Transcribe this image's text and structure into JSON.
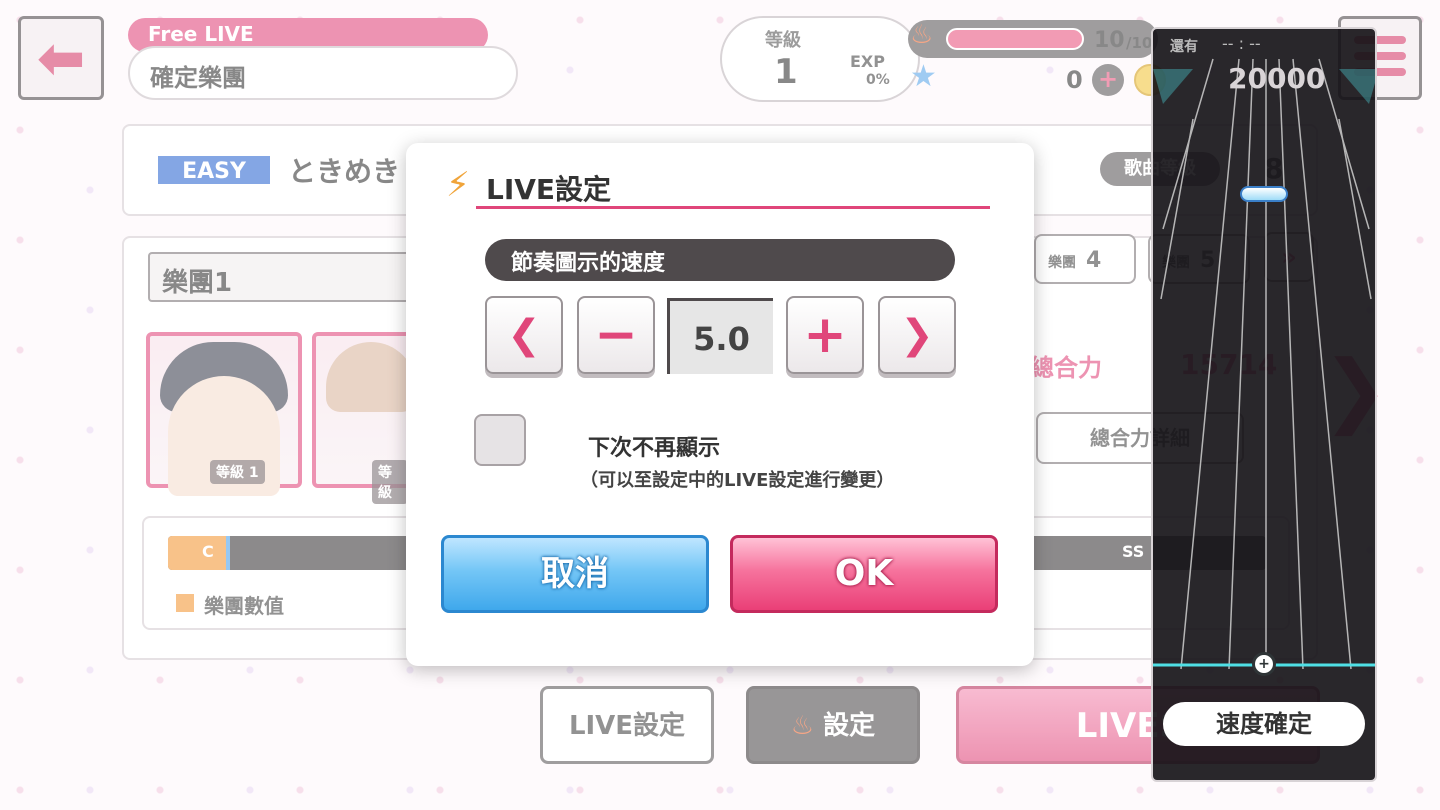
{
  "header": {
    "mode_label": "Free LIVE",
    "screen_title": "確定樂團",
    "level_label": "等級",
    "level_value": "1",
    "exp_label": "EXP",
    "exp_value": "0%",
    "stamina_value": "10",
    "stamina_max": "/10",
    "star_count": "0",
    "plus_label": "+"
  },
  "song": {
    "difficulty": "EASY",
    "title": "ときめき",
    "diff_label": "歌曲等級",
    "diff_value": "8"
  },
  "band": {
    "name": "樂團1",
    "tabs": [
      {
        "label": "樂團",
        "num": "4"
      },
      {
        "label": "樂團",
        "num": "5"
      }
    ],
    "next_label": "»",
    "cards": [
      {
        "level_label": "等級",
        "level": "1"
      },
      {
        "level_label": "等級",
        "level": ""
      }
    ],
    "power_label": "總合力",
    "power_value": "15714",
    "power_detail_label": "總合力詳細",
    "rank_c": "C",
    "rank_ss": "SS",
    "legend_label": "樂團數值"
  },
  "bottom_buttons": {
    "live_settings": "LIVE設定",
    "settings": "設定",
    "start": "LIVESt"
  },
  "modal": {
    "title": "LIVE設定",
    "speed_header": "節奏圖示的速度",
    "speed_value": "5.0",
    "prev_glyph": "❮",
    "minus_glyph": "−",
    "plus_glyph": "+",
    "next_glyph": "❯",
    "hide_label": "下次不再顯示",
    "hide_note": "（可以至設定中的LIVE設定進行變更）",
    "cancel_label": "取消",
    "ok_label": "OK"
  },
  "preview": {
    "remain_label": "還有",
    "time_text": "-- : --",
    "score": "20000",
    "confirm_label": "速度確定"
  },
  "colors": {
    "accent_pink": "#e0467a",
    "cancel_blue": "#3fa8ec",
    "ok_pink": "#ea3f77",
    "lane_cyan": "#4fe0e6"
  }
}
